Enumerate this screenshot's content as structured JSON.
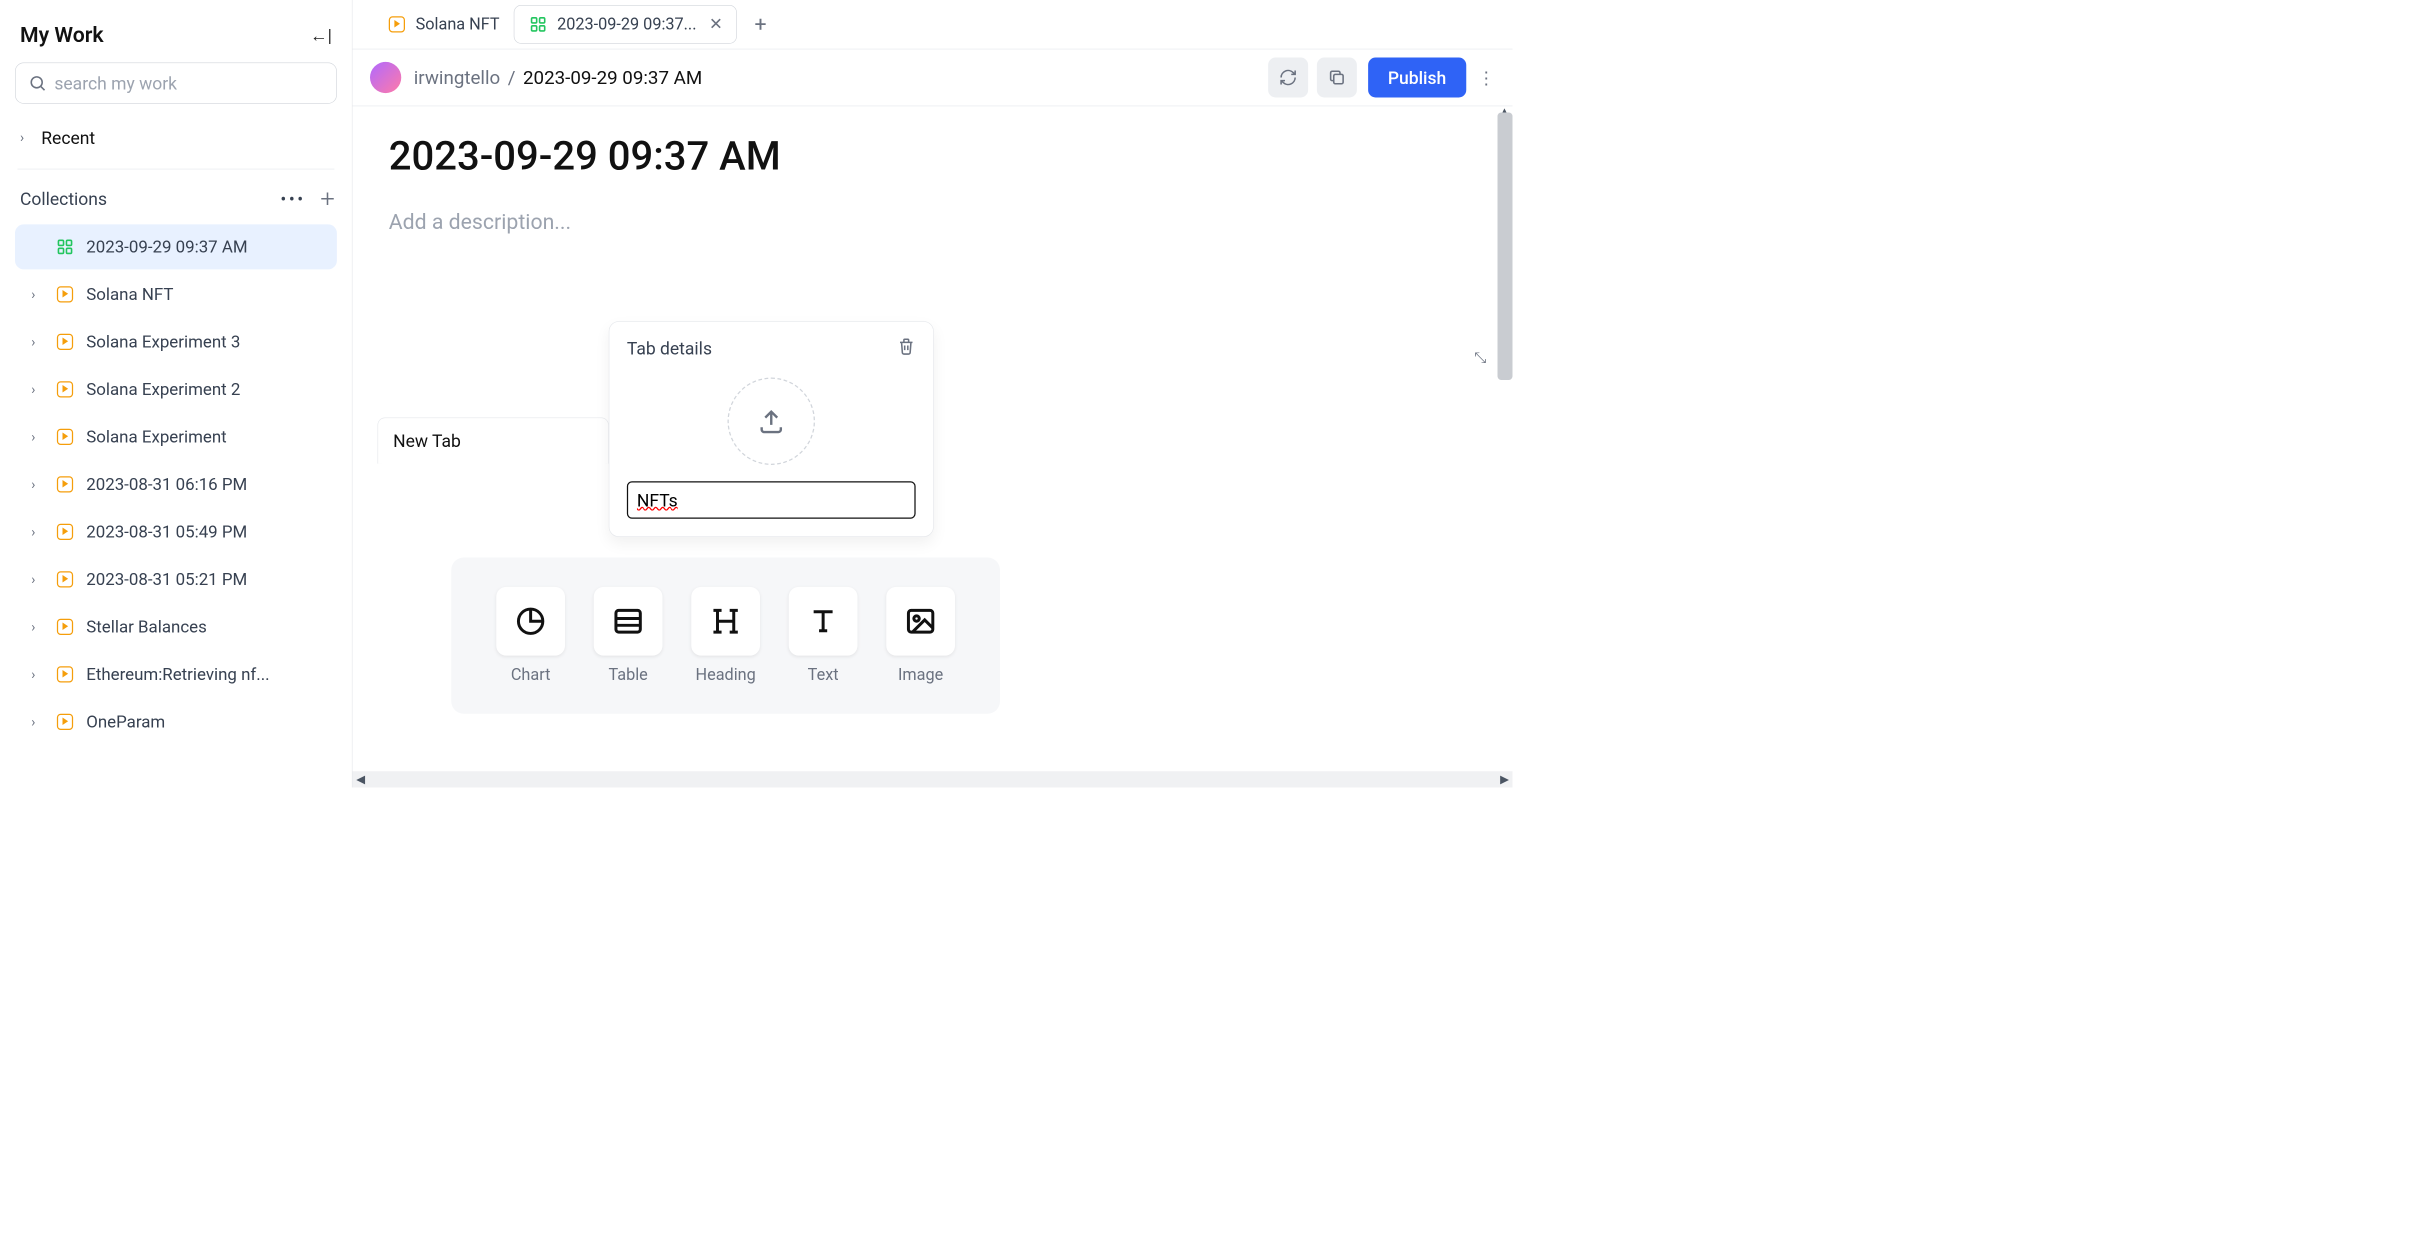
{
  "sidebar": {
    "title": "My Work",
    "search_placeholder": "search my work",
    "recent_label": "Recent",
    "collections_label": "Collections",
    "items": [
      {
        "label": "2023-09-29 09:37 AM",
        "icon": "dash",
        "active": true
      },
      {
        "label": "Solana NFT",
        "icon": "run"
      },
      {
        "label": "Solana Experiment 3",
        "icon": "run"
      },
      {
        "label": "Solana Experiment 2",
        "icon": "run"
      },
      {
        "label": "Solana Experiment",
        "icon": "run"
      },
      {
        "label": "2023-08-31 06:16 PM",
        "icon": "run"
      },
      {
        "label": "2023-08-31 05:49 PM",
        "icon": "run"
      },
      {
        "label": "2023-08-31 05:21 PM",
        "icon": "run"
      },
      {
        "label": "Stellar Balances",
        "icon": "run"
      },
      {
        "label": "Ethereum:Retrieving nf...",
        "icon": "run"
      },
      {
        "label": "OneParam",
        "icon": "run"
      }
    ]
  },
  "tabs": [
    {
      "label": "Solana NFT",
      "icon": "run",
      "active": false
    },
    {
      "label": "2023-09-29 09:37...",
      "icon": "dash",
      "active": true
    }
  ],
  "header": {
    "owner": "irwingtello",
    "current": "2023-09-29 09:37 AM",
    "publish_label": "Publish"
  },
  "doc": {
    "title": "2023-09-29 09:37 AM",
    "description_placeholder": "Add a description...",
    "newtab_label": "New Tab"
  },
  "popover": {
    "title": "Tab details",
    "input_value": "NFTs"
  },
  "palette": [
    {
      "label": "Chart",
      "icon": "chart"
    },
    {
      "label": "Table",
      "icon": "table"
    },
    {
      "label": "Heading",
      "icon": "heading"
    },
    {
      "label": "Text",
      "icon": "text"
    },
    {
      "label": "Image",
      "icon": "image"
    }
  ]
}
